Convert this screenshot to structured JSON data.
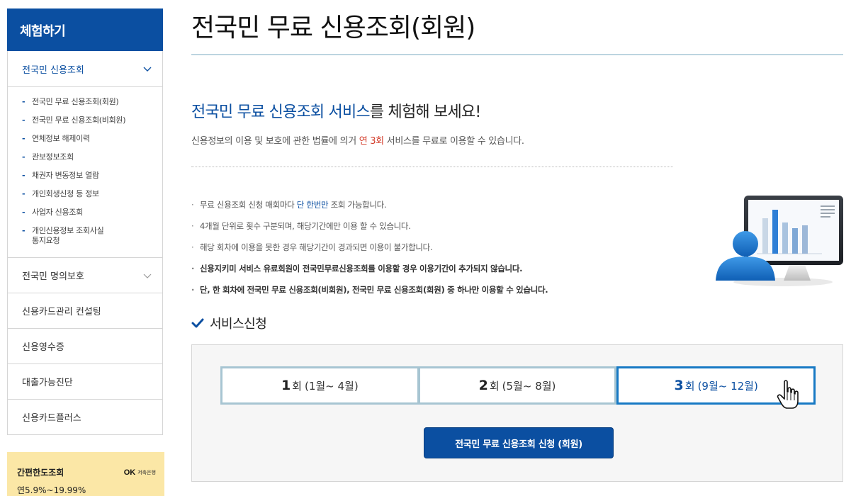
{
  "sidebar": {
    "title": "체험하기",
    "items": [
      {
        "label": "전국민 신용조회",
        "active": true,
        "expanded": true,
        "icon": "chevron-up-icon"
      },
      {
        "label": "전국민 명의보호",
        "active": false,
        "expanded": false,
        "icon": "chevron-down-icon"
      },
      {
        "label": "신용카드관리 컨설팅"
      },
      {
        "label": "신용영수증"
      },
      {
        "label": "대출가능진단"
      },
      {
        "label": "신용카드플러스"
      }
    ],
    "subitems": [
      "전국민 무료 신용조회(회원)",
      "전국민 무료 신용조회(비회원)",
      "연체정보 해제이력",
      "관보정보조회",
      "채권자 변동정보 열람",
      "개인회생신청 등 정보",
      "사업자 신용조회",
      "개인신용정보 조회사실\n통지요청"
    ],
    "promo": {
      "title": "간편한도조회",
      "rate": "연5.9%~19.99%",
      "logo_text": "OK",
      "logo_sub": "저축은행"
    }
  },
  "main": {
    "title": "전국민 무료 신용조회(회원)",
    "intro": {
      "highlight": "전국민 무료 신용조회 서비스",
      "rest": "를 체험해 보세요!",
      "desc_pre": "신용정보의 이용 및 보호에 관한 법률에 의거 ",
      "desc_red": "연 3회",
      "desc_post": " 서비스를 무료로 이용할 수 있습니다."
    },
    "notes": [
      {
        "pre": "무료 신용조회 신청 매회마다 ",
        "blue": "단 한번만",
        "post": " 조회 가능합니다.",
        "bold": false
      },
      {
        "pre": "4개월 단위로 횟수 구분되며, 해당기간에만 이용 할 수 있습니다.",
        "blue": "",
        "post": "",
        "bold": false
      },
      {
        "pre": "해당 회차에 이용을 못한 경우 해당기간이 경과되면 이용이 불가합니다.",
        "blue": "",
        "post": "",
        "bold": false
      },
      {
        "pre": "신용지키미 서비스 유료회원이 전국민무료신용조회를 이용할 경우 이용기간이 추가되지 않습니다.",
        "blue": "",
        "post": "",
        "bold": true
      },
      {
        "pre": "단, 한 회차에 전국민 무료 신용조회(비회원), 전국민 무료 신용조회(회원) 중 하나만 이용할 수 있습니다.",
        "blue": "",
        "post": "",
        "bold": true
      }
    ],
    "service": {
      "heading": "서비스신청",
      "rounds": [
        {
          "num": "1",
          "unit": "회",
          "period": "(1월~ 4월)",
          "selected": false
        },
        {
          "num": "2",
          "unit": "회",
          "period": "(5월~ 8월)",
          "selected": false
        },
        {
          "num": "3",
          "unit": "회",
          "period": "(9월~ 12월)",
          "selected": true
        }
      ],
      "button_label": "전국민 무료 신용조회 신청 (회원)"
    }
  },
  "colors": {
    "brand": "#0b4fa1",
    "accent_red": "#d33d2b",
    "round_border": "#a7c5d2",
    "round_selected": "#1779c4",
    "promo_bg": "#fbe7a6"
  }
}
